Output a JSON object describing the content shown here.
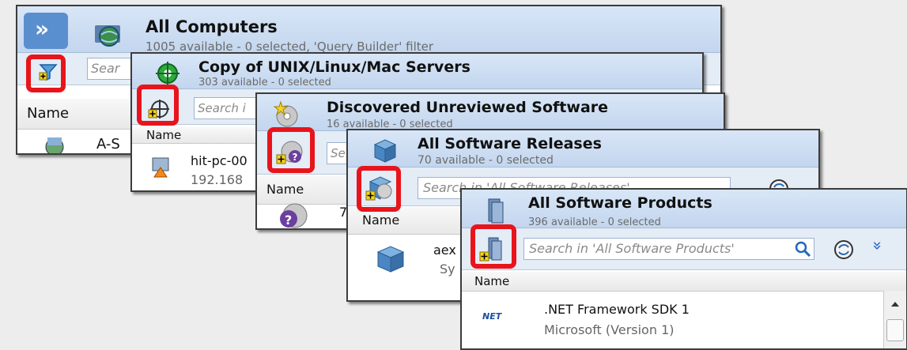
{
  "panels": {
    "all_computers": {
      "title": "All Computers",
      "subtitle": "1005 available - 0 selected, 'Query Builder' filter",
      "expand_glyph": "»",
      "search_placeholder": "Sear",
      "column_name": "Name",
      "row_name": "A-S"
    },
    "unix_servers": {
      "title": "Copy of UNIX/Linux/Mac Servers",
      "subtitle": "303 available - 0 selected",
      "search_placeholder": "Search i",
      "column_name": "Name",
      "row_name": "hit-pc-00",
      "row_detail": "192.168"
    },
    "unreviewed_software": {
      "title": "Discovered Unreviewed Software",
      "subtitle": "16 available - 0 selected",
      "search_placeholder": "Se",
      "column_name": "Name",
      "row_name": "7"
    },
    "software_releases": {
      "title": "All Software Releases",
      "subtitle": "70 available - 0 selected",
      "search_placeholder": "Search in 'All Software Releases'",
      "column_name": "Name",
      "row_name": "aex",
      "row_detail": "Sy"
    },
    "software_products": {
      "title": "All Software Products",
      "subtitle": "396 available - 0 selected",
      "search_placeholder": "Search in 'All Software Products'",
      "column_name": "Name",
      "row_name": ".NET Framework SDK 1",
      "row_detail": "Microsoft (Version 1)",
      "row_logo": "NET",
      "expand_glyph": "»"
    }
  },
  "colors": {
    "highlight": "#e8141c",
    "header": "#c9daf0"
  }
}
